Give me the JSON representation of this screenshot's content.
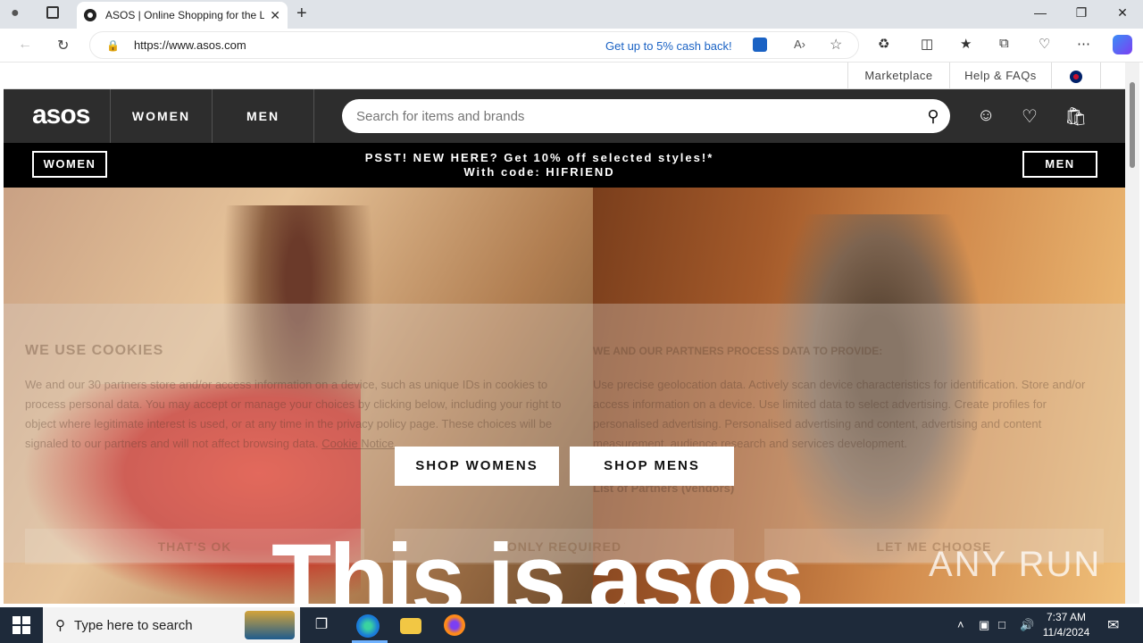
{
  "browser": {
    "tab_title": "ASOS | Online Shopping for the L",
    "url": "https://www.asos.com",
    "cashback": "Get up to 5% cash back!"
  },
  "utility_bar": {
    "items": [
      "Marketplace",
      "Help & FAQs"
    ]
  },
  "header": {
    "logo": "asos",
    "nav": [
      "WOMEN",
      "MEN"
    ],
    "search_placeholder": "Search for items and brands"
  },
  "promo": {
    "left_button": "WOMEN",
    "line1": "PSST! NEW HERE? Get 10% off selected styles!*",
    "line2": "With code: HIFRIEND",
    "right_button": "MEN"
  },
  "cookie": {
    "heading_left": "WE USE COOKIES",
    "text_left": "We and our 30 partners store and/or access information on a device, such as unique IDs in cookies to process personal data. You may accept or manage your choices by clicking below, including your right to object where legitimate interest is used, or at any time in the privacy policy page. These choices will be signaled to our partners and will not affect browsing data.",
    "link_left": "Cookie Notice.",
    "heading_right": "WE AND OUR PARTNERS PROCESS DATA TO PROVIDE:",
    "text_right": "Use precise geolocation data. Actively scan device characteristics for identification. Store and/or access information on a device. Use limited data to select advertising. Create profiles for personalised advertising. Personalised advertising and content, advertising and content measurement, audience research and services development.",
    "partners_link": "List of Partners (vendors)",
    "buttons": [
      "THAT'S OK",
      "ONLY REQUIRED",
      "LET ME CHOOSE"
    ]
  },
  "hero": {
    "shop_women": "SHOP WOMENS",
    "shop_men": "SHOP MENS",
    "big_text": "This is asos"
  },
  "watermark": "ANY RUN",
  "taskbar": {
    "search_placeholder": "Type here to search",
    "time": "7:37 AM",
    "date": "11/4/2024"
  }
}
